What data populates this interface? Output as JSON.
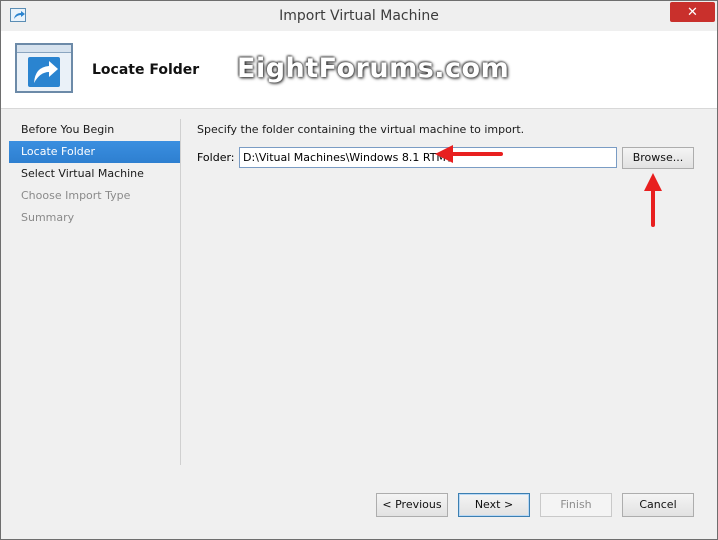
{
  "window": {
    "title": "Import Virtual Machine",
    "close_label": "✕"
  },
  "header": {
    "title": "Locate Folder",
    "watermark": "EightForums.com"
  },
  "nav": {
    "items": [
      {
        "label": "Before You Begin",
        "state": "normal"
      },
      {
        "label": "Locate Folder",
        "state": "selected"
      },
      {
        "label": "Select Virtual Machine",
        "state": "normal"
      },
      {
        "label": "Choose Import Type",
        "state": "disabled"
      },
      {
        "label": "Summary",
        "state": "disabled"
      }
    ]
  },
  "content": {
    "instruction": "Specify the folder containing the virtual machine to import.",
    "folder_label": "Folder:",
    "folder_value": "D:\\Vitual Machines\\Windows 8.1 RTM\\",
    "browse_label": "Browse..."
  },
  "footer": {
    "previous_label": "< Previous",
    "next_label": "Next >",
    "finish_label": "Finish",
    "cancel_label": "Cancel"
  },
  "colors": {
    "selected_nav": "#2e7fd0",
    "close_button": "#c9302c",
    "annotation_arrow": "#e81f1f"
  }
}
